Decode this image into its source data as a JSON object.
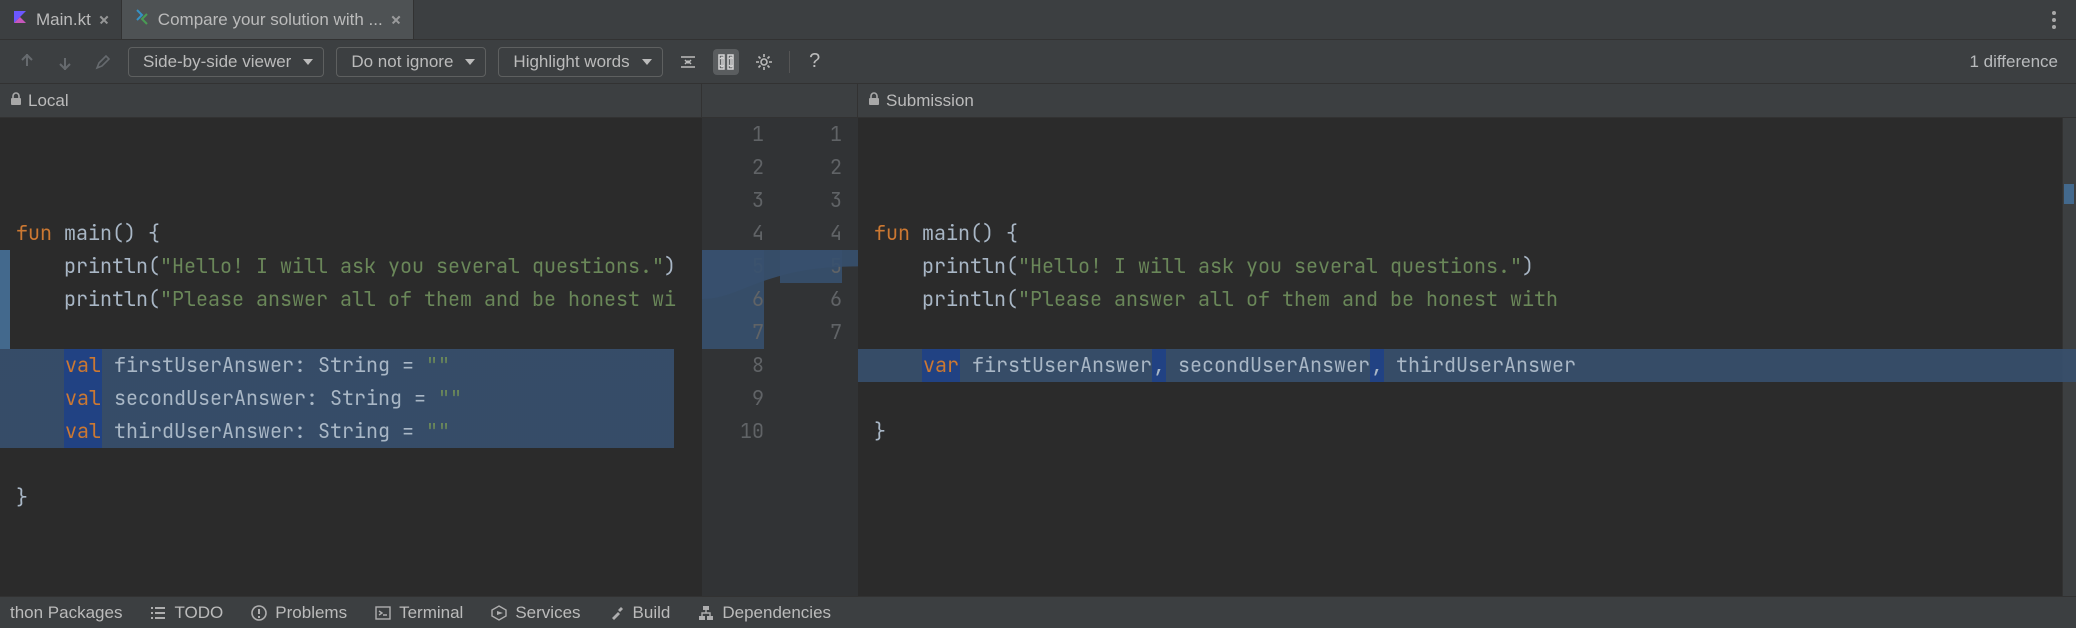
{
  "tabs": {
    "items": [
      {
        "label": "Main.kt",
        "icon": "kotlin-file-icon",
        "active": false
      },
      {
        "label": "Compare your solution with ...",
        "icon": "diff-icon",
        "active": true
      }
    ]
  },
  "toolbar": {
    "viewer_mode": "Side-by-side viewer",
    "ignore_mode": "Do not ignore",
    "highlight_mode": "Highlight words",
    "diff_count_label": "1 difference"
  },
  "panes": {
    "left_label": "Local",
    "right_label": "Submission"
  },
  "left_code": {
    "lines": [
      {
        "n": 1,
        "hl": false,
        "tokens": [
          [
            "kw",
            "fun"
          ],
          [
            "pun",
            " "
          ],
          [
            "fn",
            "main"
          ],
          [
            "pun",
            "() {"
          ]
        ]
      },
      {
        "n": 2,
        "hl": false,
        "tokens": [
          [
            "pun",
            "    "
          ],
          [
            "fn",
            "println"
          ],
          [
            "pun",
            "("
          ],
          [
            "str",
            "\"Hello! I will ask you several questions.\""
          ],
          [
            "pun",
            ")"
          ]
        ]
      },
      {
        "n": 3,
        "hl": false,
        "tokens": [
          [
            "pun",
            "    "
          ],
          [
            "fn",
            "println"
          ],
          [
            "pun",
            "("
          ],
          [
            "str",
            "\"Please answer all of them and be honest wi"
          ]
        ]
      },
      {
        "n": 4,
        "hl": false,
        "tokens": []
      },
      {
        "n": 5,
        "hl": true,
        "tokens": [
          [
            "pun",
            "    "
          ],
          [
            "kw hi-kw",
            "val"
          ],
          [
            "pun",
            " "
          ],
          [
            "id",
            "firstUserAnswer"
          ],
          [
            "pun",
            ": "
          ],
          [
            "ty",
            "String"
          ],
          [
            "pun",
            " = "
          ],
          [
            "str",
            "\"\""
          ]
        ]
      },
      {
        "n": 6,
        "hl": true,
        "tokens": [
          [
            "pun",
            "    "
          ],
          [
            "kw hi-kw",
            "val"
          ],
          [
            "pun",
            " "
          ],
          [
            "id",
            "secondUserAnswer"
          ],
          [
            "pun",
            ": "
          ],
          [
            "ty",
            "String"
          ],
          [
            "pun",
            " = "
          ],
          [
            "str",
            "\"\""
          ]
        ]
      },
      {
        "n": 7,
        "hl": true,
        "tokens": [
          [
            "pun",
            "    "
          ],
          [
            "kw hi-kw",
            "val"
          ],
          [
            "pun",
            " "
          ],
          [
            "id",
            "thirdUserAnswer"
          ],
          [
            "pun",
            ": "
          ],
          [
            "ty",
            "String"
          ],
          [
            "pun",
            " = "
          ],
          [
            "str",
            "\"\""
          ]
        ]
      },
      {
        "n": 8,
        "hl": false,
        "tokens": []
      },
      {
        "n": 9,
        "hl": false,
        "tokens": [
          [
            "pun",
            "}"
          ]
        ]
      },
      {
        "n": 10,
        "hl": false,
        "tokens": []
      }
    ]
  },
  "right_code": {
    "lines": [
      {
        "n": 1,
        "hl": false,
        "tokens": [
          [
            "kw",
            "fun"
          ],
          [
            "pun",
            " "
          ],
          [
            "fn",
            "main"
          ],
          [
            "pun",
            "() {"
          ]
        ]
      },
      {
        "n": 2,
        "hl": false,
        "tokens": [
          [
            "pun",
            "    "
          ],
          [
            "fn",
            "println"
          ],
          [
            "pun",
            "("
          ],
          [
            "str",
            "\"Hello! I will ask you several questions.\""
          ],
          [
            "pun",
            ")"
          ]
        ]
      },
      {
        "n": 3,
        "hl": false,
        "tokens": [
          [
            "pun",
            "    "
          ],
          [
            "fn",
            "println"
          ],
          [
            "pun",
            "("
          ],
          [
            "str",
            "\"Please answer all of them and be honest with"
          ]
        ]
      },
      {
        "n": 4,
        "hl": false,
        "tokens": []
      },
      {
        "n": 5,
        "hl": true,
        "tokens": [
          [
            "pun",
            "    "
          ],
          [
            "kw hi-kw",
            "var"
          ],
          [
            "pun",
            " "
          ],
          [
            "id",
            "firstUserAnswer"
          ],
          [
            "pun hi-pun",
            ","
          ],
          [
            "pun",
            " "
          ],
          [
            "id",
            "secondUserAnswer"
          ],
          [
            "pun hi-pun",
            ","
          ],
          [
            "pun",
            " "
          ],
          [
            "id",
            "thirdUserAnswer"
          ]
        ]
      },
      {
        "n": 6,
        "hl": false,
        "tokens": []
      },
      {
        "n": 7,
        "hl": false,
        "tokens": [
          [
            "pun",
            "}"
          ]
        ]
      }
    ]
  },
  "gutter": {
    "left": [
      "1",
      "2",
      "3",
      "4",
      "5",
      "6",
      "7",
      "8",
      "9",
      "10"
    ],
    "right": [
      "1",
      "2",
      "3",
      "4",
      "5",
      "6",
      "7",
      "",
      "",
      ""
    ]
  },
  "footer": {
    "items": [
      {
        "label": "thon Packages",
        "icon": ""
      },
      {
        "label": "TODO",
        "icon": "list-icon"
      },
      {
        "label": "Problems",
        "icon": "warning-icon"
      },
      {
        "label": "Terminal",
        "icon": "terminal-icon"
      },
      {
        "label": "Services",
        "icon": "services-icon"
      },
      {
        "label": "Build",
        "icon": "hammer-icon"
      },
      {
        "label": "Dependencies",
        "icon": "deps-icon"
      }
    ]
  }
}
